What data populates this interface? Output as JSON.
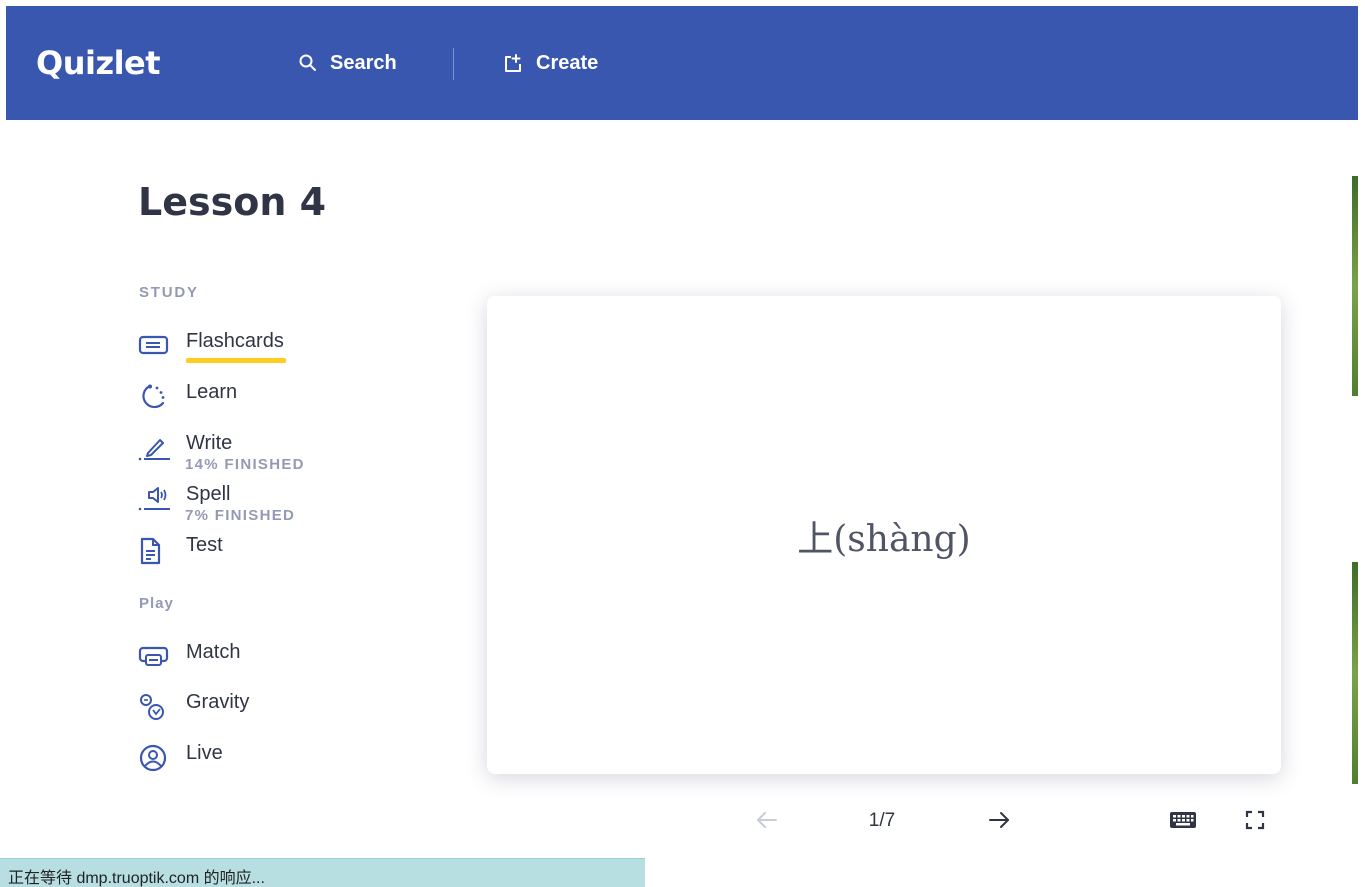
{
  "header": {
    "logo": "Quizlet",
    "search_label": "Search",
    "create_label": "Create",
    "background_color": "#3a57b0"
  },
  "page": {
    "title": "Lesson 4"
  },
  "sidebar": {
    "study_heading": "STUDY",
    "play_heading": "Play",
    "study_modes": [
      {
        "label": "Flashcards",
        "icon": "flashcards-icon",
        "active": true,
        "progress": ""
      },
      {
        "label": "Learn",
        "icon": "learn-icon",
        "progress": ""
      },
      {
        "label": "Write",
        "icon": "write-icon",
        "progress": "14% FINISHED"
      },
      {
        "label": "Spell",
        "icon": "spell-icon",
        "progress": "7% FINISHED"
      },
      {
        "label": "Test",
        "icon": "test-icon",
        "progress": ""
      }
    ],
    "play_modes": [
      {
        "label": "Match",
        "icon": "match-icon"
      },
      {
        "label": "Gravity",
        "icon": "gravity-icon"
      },
      {
        "label": "Live",
        "icon": "live-icon"
      }
    ],
    "active_underline_color": "#ffcd1f"
  },
  "flashcard": {
    "term": "上(shàng)",
    "counter": "1/7"
  },
  "controls": {
    "prev_icon": "arrow-left-icon",
    "next_icon": "arrow-right-icon",
    "keyboard_icon": "keyboard-icon",
    "fullscreen_icon": "fullscreen-icon"
  },
  "browser_status": {
    "text": "正在等待 dmp.truoptik.com 的响应..."
  }
}
